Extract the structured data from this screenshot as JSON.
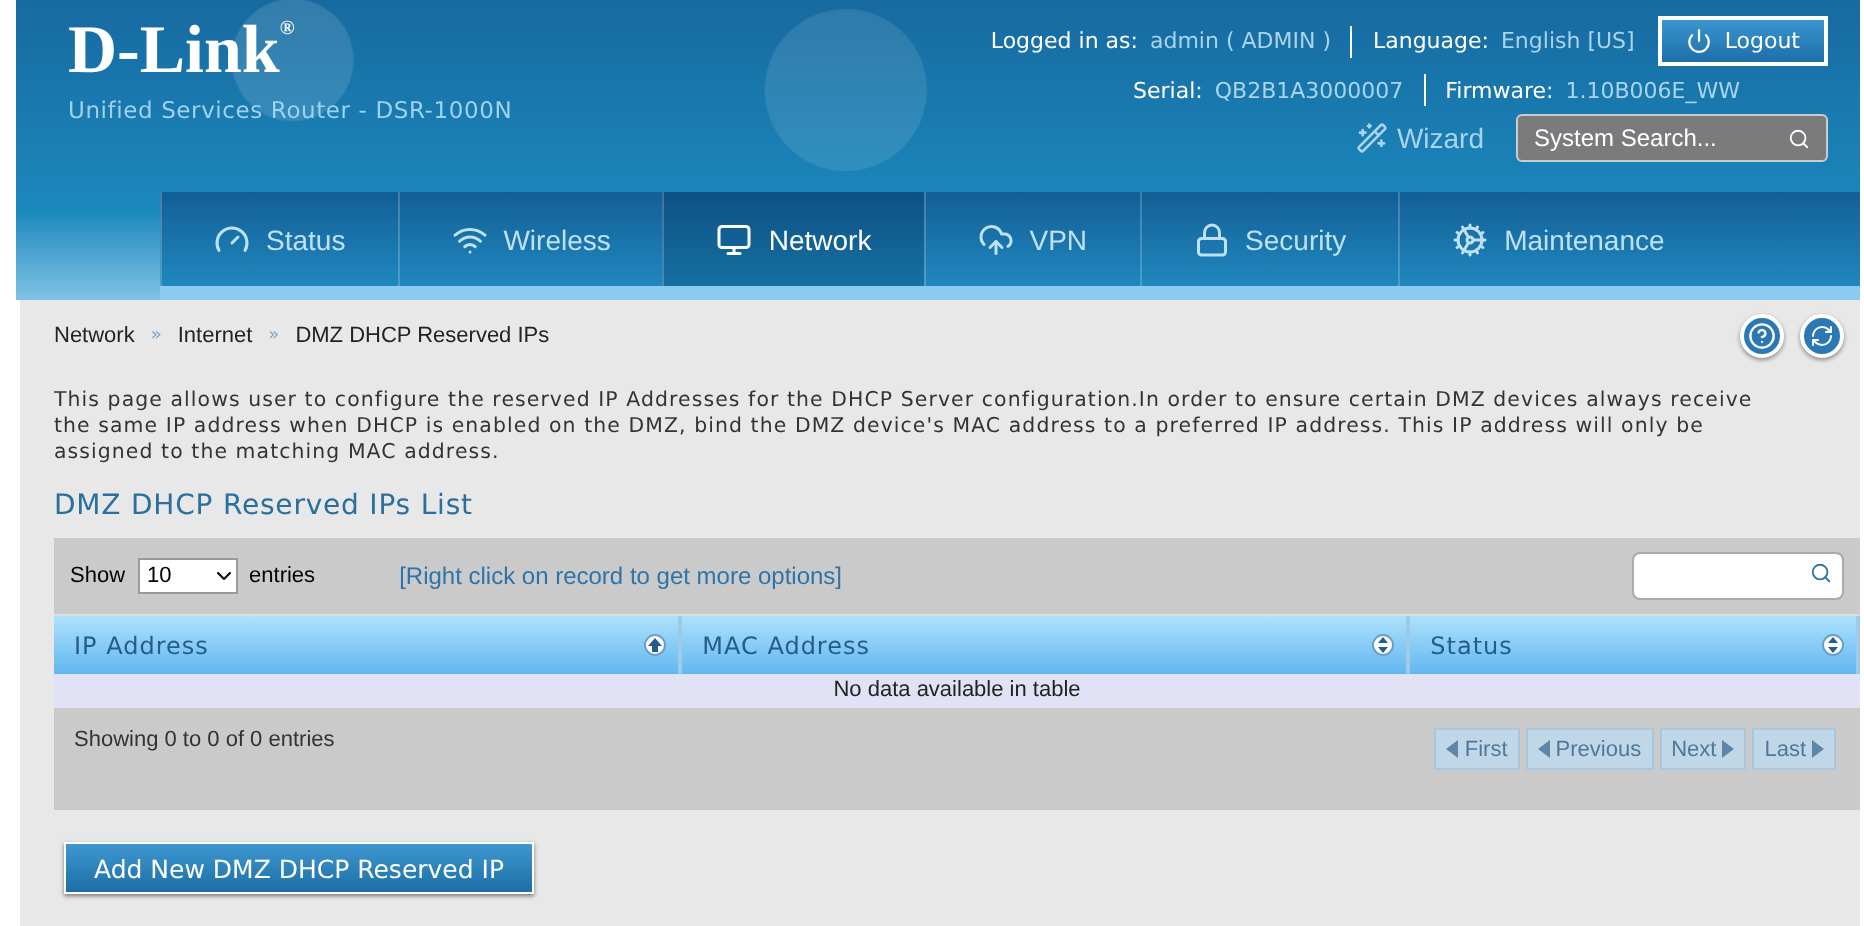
{
  "brand": {
    "logo": "D-Link",
    "registered": "®",
    "subtitle": "Unified Services Router - DSR-1000N"
  },
  "account": {
    "logged_label": "Logged in as:",
    "user": "admin ( ADMIN )",
    "language_label": "Language:",
    "language": "English [US]",
    "serial_label": "Serial:",
    "serial": "QB2B1A3000007",
    "firmware_label": "Firmware:",
    "firmware": "1.10B006E_WW",
    "logout": "Logout",
    "wizard": "Wizard",
    "search": {
      "placeholder": "System Search..."
    }
  },
  "nav": [
    {
      "label": "Status",
      "selected": false
    },
    {
      "label": "Wireless",
      "selected": false
    },
    {
      "label": "Network",
      "selected": true
    },
    {
      "label": "VPN",
      "selected": false
    },
    {
      "label": "Security",
      "selected": false
    },
    {
      "label": "Maintenance",
      "selected": false
    }
  ],
  "breadcrumb": [
    "Network",
    "Internet",
    "DMZ DHCP Reserved IPs"
  ],
  "breadcrumb_separator": "»",
  "description": "This page allows user to configure the reserved IP Addresses for the DHCP Server configuration.In order to ensure certain DMZ devices always receive the same IP address when DHCP is enabled on the DMZ, bind the DMZ device's MAC address to a preferred IP address. This IP address will only be assigned to the matching MAC address.",
  "list": {
    "title": "DMZ DHCP Reserved IPs List",
    "show_label": "Show",
    "page_size": "10",
    "entries_label": "entries",
    "hint": "[Right click on record to get more options]",
    "columns": [
      {
        "label": "IP Address",
        "sorted": true
      },
      {
        "label": "MAC Address",
        "sorted": false
      },
      {
        "label": "Status",
        "sorted": false
      }
    ],
    "empty": "No data available in table",
    "info": "Showing 0 to 0 of 0 entries",
    "pager": [
      {
        "label": "First",
        "kind": "first",
        "disabled": true
      },
      {
        "label": "Previous",
        "kind": "prev",
        "disabled": true
      },
      {
        "label": "Next",
        "kind": "next",
        "disabled": true
      },
      {
        "label": "Last",
        "kind": "last",
        "disabled": true
      }
    ]
  },
  "add_button": "Add New DMZ DHCP Reserved IP"
}
